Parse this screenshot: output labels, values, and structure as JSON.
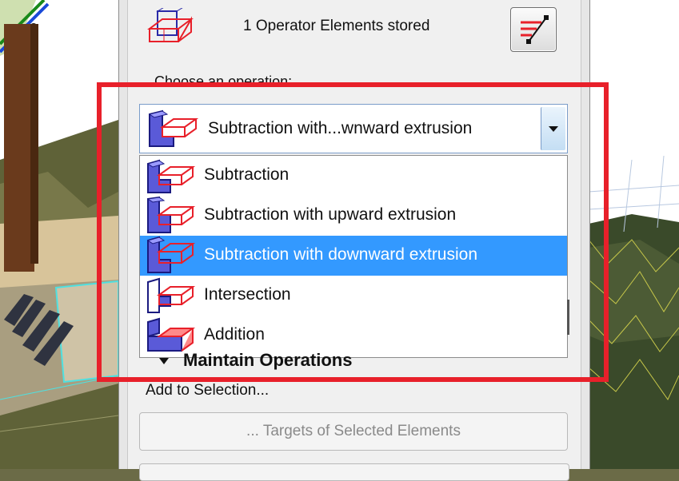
{
  "header": {
    "stored_text": "1 Operator Elements stored"
  },
  "choose_label": "Choose an operation:",
  "combo": {
    "value": "Subtraction with...wnward extrusion"
  },
  "options": [
    {
      "label": "Subtraction",
      "selected": false
    },
    {
      "label": "Subtraction with upward extrusion",
      "selected": false
    },
    {
      "label": "Subtraction with downward extrusion",
      "selected": true
    },
    {
      "label": "Intersection",
      "selected": false
    },
    {
      "label": "Addition",
      "selected": false
    }
  ],
  "maintain": {
    "label": "Maintain Operations"
  },
  "add_to_selection": "Add to Selection...",
  "targets_button": "... Targets of Selected Elements",
  "colors": {
    "highlight": "#e8202a",
    "selection": "#3399ff",
    "operator_red": "#e8202a",
    "target_blue": "#2a2aa8"
  }
}
